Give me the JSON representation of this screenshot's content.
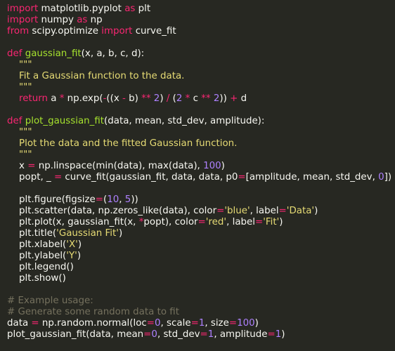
{
  "theme": {
    "background": "#272822",
    "foreground": "#f8f8f2",
    "keyword": "#f92672",
    "function": "#a6e22e",
    "string": "#e6db74",
    "number": "#ae81ff",
    "comment": "#75715e"
  },
  "lines": [
    [
      [
        "kw",
        "import"
      ],
      [
        "pl",
        " matplotlib.pyplot "
      ],
      [
        "kw",
        "as"
      ],
      [
        "pl",
        " plt"
      ]
    ],
    [
      [
        "kw",
        "import"
      ],
      [
        "pl",
        " numpy "
      ],
      [
        "kw",
        "as"
      ],
      [
        "pl",
        " np"
      ]
    ],
    [
      [
        "kw",
        "from"
      ],
      [
        "pl",
        " scipy.optimize "
      ],
      [
        "kw",
        "import"
      ],
      [
        "pl",
        " curve_fit"
      ]
    ],
    [],
    [
      [
        "kw",
        "def"
      ],
      [
        "pl",
        " "
      ],
      [
        "fn",
        "gaussian_fit"
      ],
      [
        "pl",
        "(x, a, b, c, d):"
      ]
    ],
    [
      [
        "str",
        "    \"\"\""
      ]
    ],
    [
      [
        "str",
        "    Fit a Gaussian function to the data."
      ]
    ],
    [
      [
        "str",
        "    \"\"\""
      ]
    ],
    [
      [
        "pl",
        "    "
      ],
      [
        "kw",
        "return"
      ],
      [
        "pl",
        " a "
      ],
      [
        "kw",
        "*"
      ],
      [
        "pl",
        " np.exp("
      ],
      [
        "kw",
        "-"
      ],
      [
        "pl",
        "((x "
      ],
      [
        "kw",
        "-"
      ],
      [
        "pl",
        " b) "
      ],
      [
        "kw",
        "**"
      ],
      [
        "pl",
        " "
      ],
      [
        "num",
        "2"
      ],
      [
        "pl",
        ") "
      ],
      [
        "kw",
        "/"
      ],
      [
        "pl",
        " ("
      ],
      [
        "num",
        "2"
      ],
      [
        "pl",
        " "
      ],
      [
        "kw",
        "*"
      ],
      [
        "pl",
        " c "
      ],
      [
        "kw",
        "**"
      ],
      [
        "pl",
        " "
      ],
      [
        "num",
        "2"
      ],
      [
        "pl",
        "))"
      ],
      [
        "pl",
        " "
      ],
      [
        "kw",
        "+"
      ],
      [
        "pl",
        " d"
      ]
    ],
    [],
    [
      [
        "kw",
        "def"
      ],
      [
        "pl",
        " "
      ],
      [
        "fn",
        "plot_gaussian_fit"
      ],
      [
        "pl",
        "(data, mean, std_dev, amplitude):"
      ]
    ],
    [
      [
        "str",
        "    \"\"\""
      ]
    ],
    [
      [
        "str",
        "    Plot the data and the fitted Gaussian function."
      ]
    ],
    [
      [
        "str",
        "    \"\"\""
      ]
    ],
    [
      [
        "pl",
        "    x "
      ],
      [
        "kw",
        "="
      ],
      [
        "pl",
        " np.linspace(min(data), max(data), "
      ],
      [
        "num",
        "100"
      ],
      [
        "pl",
        ")"
      ]
    ],
    [
      [
        "pl",
        "    popt, _ "
      ],
      [
        "kw",
        "="
      ],
      [
        "pl",
        " curve_fit(gaussian_fit, data, data, p0"
      ],
      [
        "kw",
        "="
      ],
      [
        "pl",
        "[amplitude, mean, std_dev, "
      ],
      [
        "num",
        "0"
      ],
      [
        "pl",
        "])"
      ]
    ],
    [],
    [
      [
        "pl",
        "    plt.figure(figsize"
      ],
      [
        "kw",
        "="
      ],
      [
        "pl",
        "("
      ],
      [
        "num",
        "10"
      ],
      [
        "pl",
        ", "
      ],
      [
        "num",
        "5"
      ],
      [
        "pl",
        "))"
      ]
    ],
    [
      [
        "pl",
        "    plt.scatter(data, np.zeros_like(data), color"
      ],
      [
        "kw",
        "="
      ],
      [
        "str",
        "'blue'"
      ],
      [
        "pl",
        ", label"
      ],
      [
        "kw",
        "="
      ],
      [
        "str",
        "'Data'"
      ],
      [
        "pl",
        ")"
      ]
    ],
    [
      [
        "pl",
        "    plt.plot(x, gaussian_fit(x, "
      ],
      [
        "kw",
        "*"
      ],
      [
        "pl",
        "popt), color"
      ],
      [
        "kw",
        "="
      ],
      [
        "str",
        "'red'"
      ],
      [
        "pl",
        ", label"
      ],
      [
        "kw",
        "="
      ],
      [
        "str",
        "'Fit'"
      ],
      [
        "pl",
        ")"
      ]
    ],
    [
      [
        "pl",
        "    plt.title("
      ],
      [
        "str",
        "'Gaussian Fit'"
      ],
      [
        "pl",
        ")"
      ]
    ],
    [
      [
        "pl",
        "    plt.xlabel("
      ],
      [
        "str",
        "'X'"
      ],
      [
        "pl",
        ")"
      ]
    ],
    [
      [
        "pl",
        "    plt.ylabel("
      ],
      [
        "str",
        "'Y'"
      ],
      [
        "pl",
        ")"
      ]
    ],
    [
      [
        "pl",
        "    plt.legend()"
      ]
    ],
    [
      [
        "pl",
        "    plt.show()"
      ]
    ],
    [],
    [
      [
        "cm",
        "# Example usage:"
      ]
    ],
    [
      [
        "cm",
        "# Generate some random data to fit"
      ]
    ],
    [
      [
        "pl",
        "data "
      ],
      [
        "kw",
        "="
      ],
      [
        "pl",
        " np.random.normal(loc"
      ],
      [
        "kw",
        "="
      ],
      [
        "num",
        "0"
      ],
      [
        "pl",
        ", scale"
      ],
      [
        "kw",
        "="
      ],
      [
        "num",
        "1"
      ],
      [
        "pl",
        ", size"
      ],
      [
        "kw",
        "="
      ],
      [
        "num",
        "100"
      ],
      [
        "pl",
        ")"
      ]
    ],
    [
      [
        "pl",
        "plot_gaussian_fit(data, mean"
      ],
      [
        "kw",
        "="
      ],
      [
        "num",
        "0"
      ],
      [
        "pl",
        ", std_dev"
      ],
      [
        "kw",
        "="
      ],
      [
        "num",
        "1"
      ],
      [
        "pl",
        ", amplitude"
      ],
      [
        "kw",
        "="
      ],
      [
        "num",
        "1"
      ],
      [
        "pl",
        ")"
      ]
    ]
  ]
}
